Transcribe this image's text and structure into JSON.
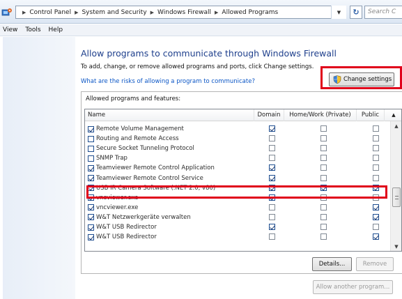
{
  "address_bar": {
    "breadcrumbs": [
      "Control Panel",
      "System and Security",
      "Windows Firewall",
      "Allowed Programs"
    ],
    "search_placeholder": "Search C",
    "icon": "control-panel-icon"
  },
  "menu": [
    "View",
    "Tools",
    "Help"
  ],
  "main": {
    "title": "Allow programs to communicate through Windows Firewall",
    "description": "To add, change, or remove allowed programs and ports, click Change settings.",
    "risk_link": "What are the risks of allowing a program to communicate?",
    "change_settings_label": "Change settings",
    "group_label": "Allowed programs and features:"
  },
  "table": {
    "columns": [
      "Name",
      "Domain",
      "Home/Work (Private)",
      "Public"
    ],
    "rows": [
      {
        "name": "Remote Volume Management",
        "enabled": true,
        "domain": true,
        "home": false,
        "public": false
      },
      {
        "name": "Routing and Remote Access",
        "enabled": false,
        "domain": false,
        "home": false,
        "public": false
      },
      {
        "name": "Secure Socket Tunneling Protocol",
        "enabled": false,
        "domain": false,
        "home": false,
        "public": false
      },
      {
        "name": "SNMP Trap",
        "enabled": false,
        "domain": false,
        "home": false,
        "public": false
      },
      {
        "name": "Teamviewer Remote Control Application",
        "enabled": true,
        "domain": true,
        "home": false,
        "public": false
      },
      {
        "name": "Teamviewer Remote Control Service",
        "enabled": true,
        "domain": true,
        "home": false,
        "public": false
      },
      {
        "name": "USB IR Camera Software (.NET 2.0, v80)",
        "enabled": true,
        "domain": true,
        "home": true,
        "public": true
      },
      {
        "name": "vncviewer.exe",
        "enabled": true,
        "domain": true,
        "home": false,
        "public": false
      },
      {
        "name": "vncviewer.exe",
        "enabled": true,
        "domain": false,
        "home": false,
        "public": true
      },
      {
        "name": "W&T Netzwerkgeräte verwalten",
        "enabled": true,
        "domain": false,
        "home": false,
        "public": true
      },
      {
        "name": "W&T USB Redirector",
        "enabled": true,
        "domain": true,
        "home": false,
        "public": false
      },
      {
        "name": "W&T USB Redirector",
        "enabled": true,
        "domain": false,
        "home": false,
        "public": true
      }
    ]
  },
  "buttons": {
    "details": "Details...",
    "remove": "Remove",
    "allow_another": "Allow another program..."
  },
  "colors": {
    "highlight_red": "#e0001a",
    "title_blue": "#1e3f8c",
    "link_blue": "#0b56c6"
  }
}
